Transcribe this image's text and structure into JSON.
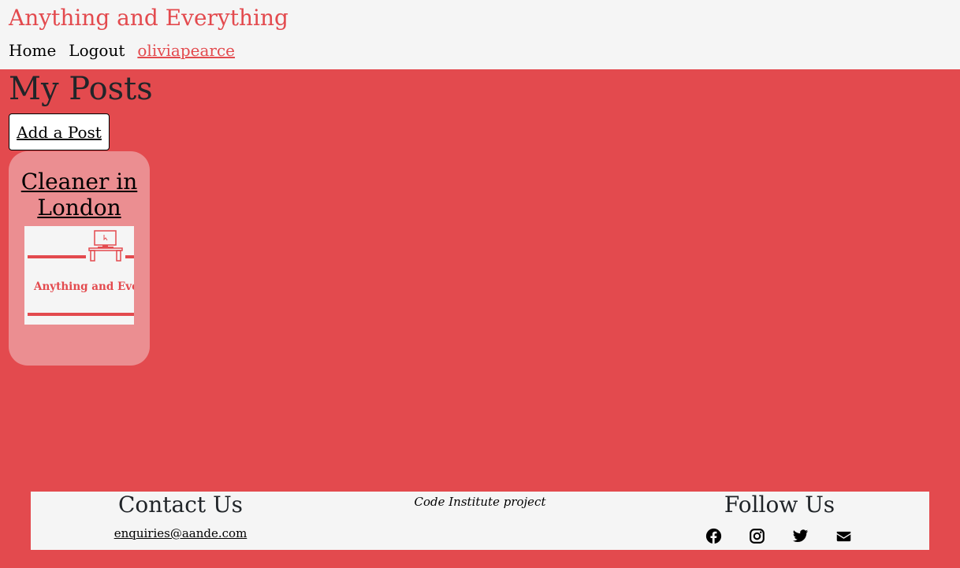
{
  "header": {
    "brand": "Anything and Everything",
    "nav": {
      "home": "Home",
      "logout": "Logout",
      "user": "oliviapearce"
    }
  },
  "main": {
    "title": "My Posts",
    "add_post_label": "Add a Post",
    "posts": [
      {
        "title": "Cleaner in London",
        "image_logo_text": "Anything and Eve"
      }
    ]
  },
  "footer": {
    "contact_title": "Contact Us",
    "contact_email": "enquiries@aande.com",
    "project_note": "Code Institute project",
    "follow_title": "Follow Us",
    "social_icons": [
      "facebook-icon",
      "instagram-icon",
      "twitter-icon",
      "envelope-icon"
    ]
  },
  "colors": {
    "accent": "#e34a4e",
    "header_bg": "#f5f5f5",
    "card_bg": "#eb8e91"
  }
}
